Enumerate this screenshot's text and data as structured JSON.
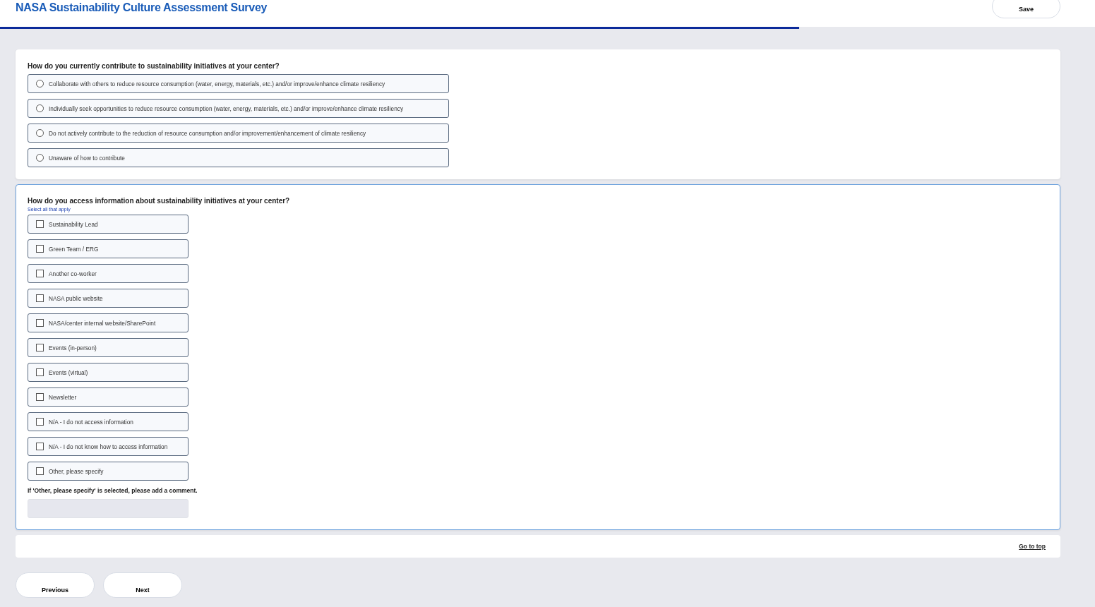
{
  "header": {
    "title": "NASA Sustainability Culture Assessment Survey",
    "save_button": "Save",
    "progress": {
      "level": 0.73
    }
  },
  "questions": [
    {
      "kind": "radio",
      "prompt": "How do you currently contribute to sustainability initiatives at your center?",
      "focused": false,
      "options": [
        {
          "label": "Collaborate with others to reduce resource consumption (water, energy, materials, etc.) and/or improve/enhance climate resiliency",
          "selected": false
        },
        {
          "label": "Individually seek opportunities to reduce resource consumption (water, energy, materials, etc.) and/or improve/enhance climate resiliency",
          "selected": false
        },
        {
          "label": "Do not actively contribute to the reduction of resource consumption and/or improvement/enhancement of climate resiliency",
          "selected": false
        },
        {
          "label": "Unaware of how to contribute",
          "selected": false
        }
      ]
    },
    {
      "kind": "checkbox",
      "prompt": "How do you access information about sustainability initiatives at your center?",
      "hint": "Select all that apply",
      "focused": true,
      "options": [
        {
          "label": "Sustainability Lead",
          "checked": false
        },
        {
          "label": "Green Team / ERG",
          "checked": false
        },
        {
          "label": "Another co-worker",
          "checked": false
        },
        {
          "label": "NASA public website",
          "checked": false
        },
        {
          "label": "NASA/center internal website/SharePoint",
          "checked": false
        },
        {
          "label": "Events (in-person)",
          "checked": false
        },
        {
          "label": "Events (virtual)",
          "checked": false
        },
        {
          "label": "Newsletter",
          "checked": false
        },
        {
          "label": "N/A - I do not access information",
          "checked": false
        },
        {
          "label": "N/A - I do not know how to access information",
          "checked": false
        },
        {
          "label": "Other, please specify",
          "checked": false
        }
      ],
      "comment": {
        "label": "If 'Other, please specify' is selected, please add a comment.",
        "disabled": true
      }
    }
  ],
  "go_to_top": "Go to top",
  "nav_buttons": [
    "Previous",
    "Next"
  ]
}
